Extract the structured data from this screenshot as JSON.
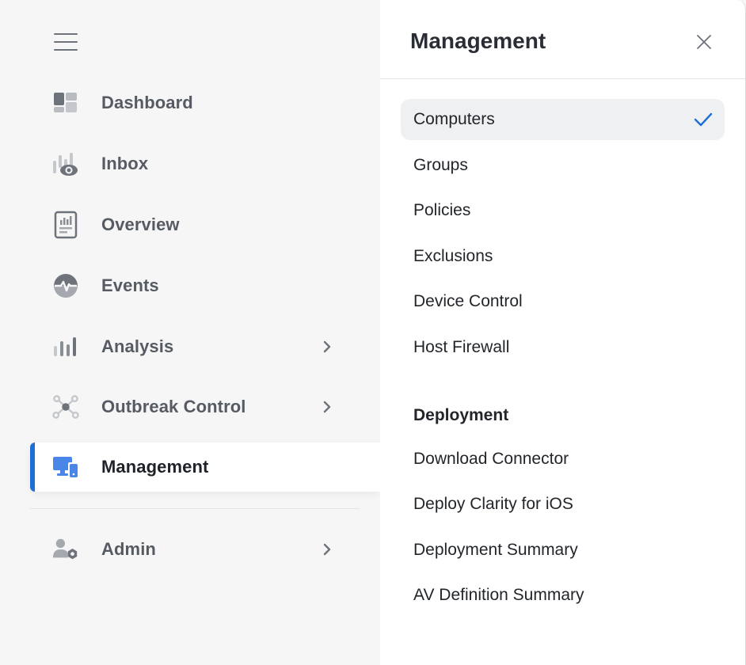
{
  "sidebar": {
    "menu_icon": "hamburger-icon",
    "items": [
      {
        "label": "Dashboard",
        "icon": "dashboard-icon",
        "has_submenu": false
      },
      {
        "label": "Inbox",
        "icon": "inbox-eye-icon",
        "has_submenu": false
      },
      {
        "label": "Overview",
        "icon": "overview-report-icon",
        "has_submenu": false
      },
      {
        "label": "Events",
        "icon": "events-pulse-icon",
        "has_submenu": false
      },
      {
        "label": "Analysis",
        "icon": "analysis-bars-icon",
        "has_submenu": true
      },
      {
        "label": "Outbreak Control",
        "icon": "outbreak-network-icon",
        "has_submenu": true
      },
      {
        "label": "Management",
        "icon": "management-devices-icon",
        "has_submenu": false,
        "active": true
      },
      {
        "label": "Admin",
        "icon": "admin-user-gear-icon",
        "has_submenu": true
      }
    ],
    "active_color": "#1d6fd6"
  },
  "panel": {
    "title": "Management",
    "close_icon": "close-icon",
    "items": [
      {
        "label": "Computers",
        "selected": true
      },
      {
        "label": "Groups"
      },
      {
        "label": "Policies"
      },
      {
        "label": "Exclusions"
      },
      {
        "label": "Device Control"
      },
      {
        "label": "Host Firewall"
      }
    ],
    "sections": [
      {
        "header": "Deployment",
        "items": [
          {
            "label": "Download Connector"
          },
          {
            "label": "Deploy Clarity for iOS"
          },
          {
            "label": "Deployment Summary"
          },
          {
            "label": "AV Definition Summary"
          }
        ]
      }
    ]
  }
}
